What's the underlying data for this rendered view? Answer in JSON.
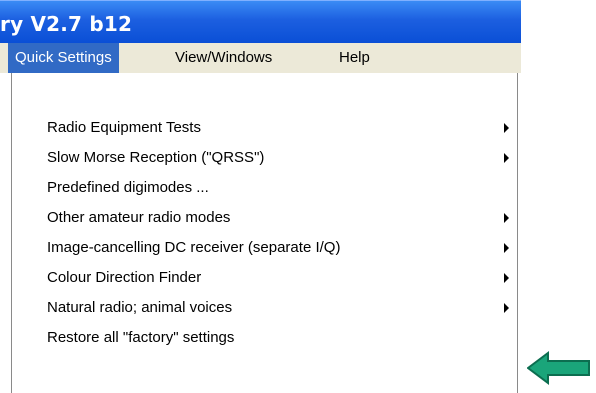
{
  "window": {
    "title": "ry V2.7 b12"
  },
  "menubar": {
    "items": [
      {
        "label": "Quick Settings",
        "active": true
      },
      {
        "label": "View/Windows",
        "active": false
      },
      {
        "label": "Help",
        "active": false
      }
    ]
  },
  "dropdown": {
    "items": [
      {
        "label": "Radio Equipment Tests",
        "submenu": true
      },
      {
        "label": "Slow Morse Reception (\"QRSS\")",
        "submenu": true
      },
      {
        "label": "Predefined digimodes ...",
        "submenu": false
      },
      {
        "label": "Other amateur radio modes",
        "submenu": true
      },
      {
        "label": "Image-cancelling DC receiver (separate I/Q)",
        "submenu": true
      },
      {
        "label": "Colour Direction Finder",
        "submenu": true
      },
      {
        "label": "Natural radio;  animal voices",
        "submenu": true
      },
      {
        "label": "Restore all \"factory\" settings",
        "submenu": false
      }
    ]
  },
  "annotation": {
    "icon": "left-arrow-icon",
    "fill_color": "#1aa57a",
    "stroke_color": "#0c6e50"
  },
  "colors": {
    "titlebar_blue": "#0a4fd6",
    "menu_highlight": "#316ac5",
    "menubar_bg": "#ece9d8"
  }
}
